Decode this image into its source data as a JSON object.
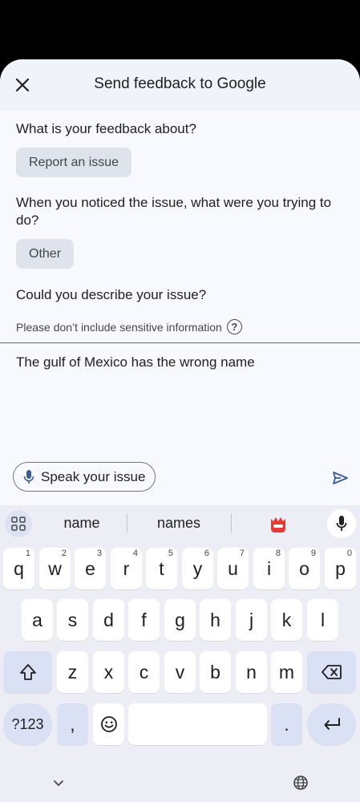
{
  "header": {
    "title": "Send feedback to Google",
    "close_icon": "close-icon"
  },
  "form": {
    "q1": "What is your feedback about?",
    "q1_answer": "Report an issue",
    "q2": "When you noticed the issue, what were you trying to do?",
    "q2_answer": "Other",
    "q3": "Could you describe your issue?",
    "hint": "Please don’t include sensitive information",
    "description_value": "The gulf of Mexico has the wrong name",
    "speak_label": "Speak your issue"
  },
  "keyboard": {
    "suggestions": [
      "name",
      "names"
    ],
    "row1": [
      {
        "k": "q",
        "n": "1"
      },
      {
        "k": "w",
        "n": "2"
      },
      {
        "k": "e",
        "n": "3"
      },
      {
        "k": "r",
        "n": "4"
      },
      {
        "k": "t",
        "n": "5"
      },
      {
        "k": "y",
        "n": "6"
      },
      {
        "k": "u",
        "n": "7"
      },
      {
        "k": "i",
        "n": "8"
      },
      {
        "k": "o",
        "n": "9"
      },
      {
        "k": "p",
        "n": "0"
      }
    ],
    "row2": [
      "a",
      "s",
      "d",
      "f",
      "g",
      "h",
      "j",
      "k",
      "l"
    ],
    "row3": [
      "z",
      "x",
      "c",
      "v",
      "b",
      "n",
      "m"
    ],
    "symbols_label": "?123",
    "comma_label": ",",
    "period_label": "."
  },
  "colors": {
    "sheet_bg": "#f1f3fb",
    "chip_bg": "#dfe3ec",
    "keyboard_bg": "#edeef5",
    "accent": "#3c5a99"
  }
}
